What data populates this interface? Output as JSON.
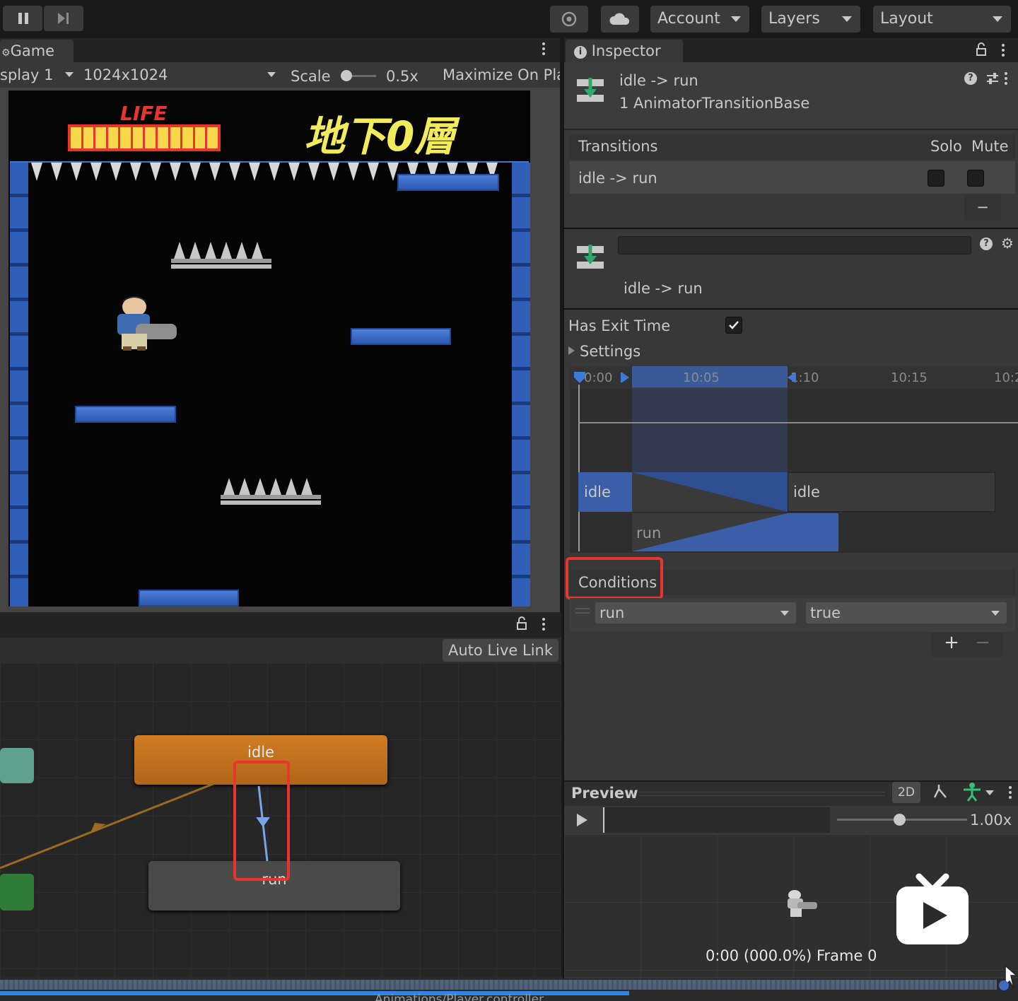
{
  "toolbar": {
    "account_label": "Account",
    "layers_label": "Layers",
    "layout_label": "Layout"
  },
  "game": {
    "tab_label": "Game",
    "display_label": "splay 1",
    "resolution_label": "1024x1024",
    "scale_label": "Scale",
    "scale_value": "0.5x",
    "maximize_label": "Maximize On Pla",
    "hud_life": "LIFE",
    "hud_floor": "地下0層"
  },
  "animator": {
    "auto_live_link_label": "Auto Live Link",
    "state_idle": "idle",
    "state_run": "run",
    "footer_path": "Animations/Player.controller"
  },
  "inspector": {
    "tab_label": "Inspector",
    "header_title": "idle -> run",
    "header_subtitle": "1 AnimatorTransitionBase",
    "transitions_label": "Transitions",
    "solo_label": "Solo",
    "mute_label": "Mute",
    "transition_row_label": "idle -> run",
    "minus_label": "−",
    "transition_name": "idle -> run",
    "has_exit_time_label": "Has Exit Time",
    "has_exit_time_checked": true,
    "settings_label": "Settings",
    "timeline_ticks": [
      "0:00",
      "10:05",
      "1:10",
      "10:15",
      "10:2"
    ],
    "timeline_idle_a": "idle",
    "timeline_idle_b": "idle",
    "timeline_run": "run",
    "conditions_label": "Conditions",
    "condition_param": "run",
    "condition_value": "true",
    "plus_label": "+",
    "minus2_label": "−"
  },
  "preview": {
    "title": "Preview",
    "mode_2d": "2D",
    "speed_label": "1.00x",
    "frame_label": "0:00 (000.0%) Frame 0"
  },
  "colors": {
    "accent_blue": "#3f6bc4",
    "idle_state": "#c0701c",
    "highlight_red": "#e8362c"
  }
}
